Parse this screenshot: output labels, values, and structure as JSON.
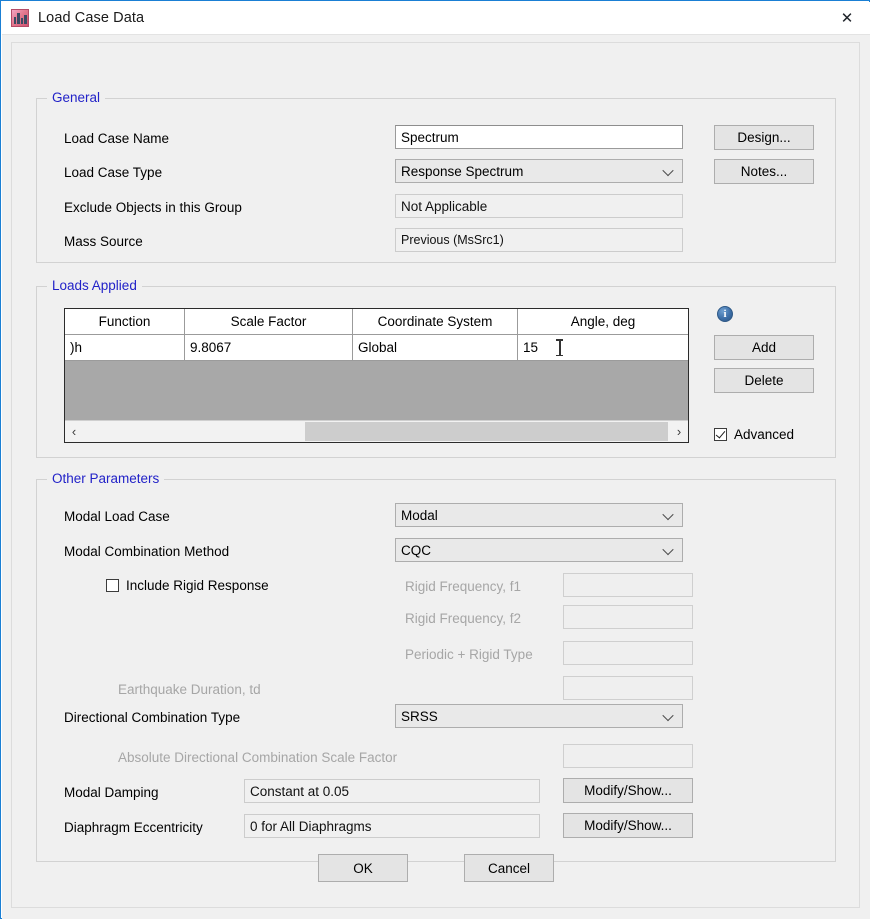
{
  "window": {
    "title": "Load Case Data",
    "icon": "building-icon",
    "close_label": "✕"
  },
  "general": {
    "legend": "General",
    "rows": [
      {
        "label": "Load Case Name",
        "value": "Spectrum",
        "kind": "textbox"
      },
      {
        "label": "Load Case Type",
        "value": "Response Spectrum",
        "kind": "combo"
      },
      {
        "label": "Exclude Objects in this Group",
        "value": "Not Applicable",
        "kind": "readonly"
      },
      {
        "label": "Mass Source",
        "value": "Previous  (MsSrc1)",
        "kind": "readonly"
      }
    ],
    "design_button": "Design...",
    "notes_button": "Notes..."
  },
  "loads_applied": {
    "legend": "Loads Applied",
    "columns": [
      "Function",
      "Scale Factor",
      "Coordinate System",
      "Angle, deg"
    ],
    "rows": [
      {
        "function": ")h",
        "scale_factor": "9.8067",
        "coordinate_system": "Global",
        "angle": "15"
      }
    ],
    "info_icon": "info-icon",
    "info_glyph": "i",
    "add_button": "Add",
    "delete_button": "Delete",
    "advanced_checkbox": {
      "label": "Advanced",
      "checked": true
    },
    "scroll_left_glyph": "‹",
    "scroll_right_glyph": "›"
  },
  "other_parameters": {
    "legend": "Other Parameters",
    "modal_load_case": {
      "label": "Modal Load Case",
      "value": "Modal"
    },
    "modal_combination_method": {
      "label": "Modal Combination Method",
      "value": "CQC"
    },
    "include_rigid_response": {
      "label": "Include Rigid Response",
      "checked": false
    },
    "rigid_frequency_f1": {
      "label": "Rigid Frequency, f1",
      "value": "",
      "disabled": true
    },
    "rigid_frequency_f2": {
      "label": "Rigid Frequency, f2",
      "value": "",
      "disabled": true
    },
    "periodic_rigid_type": {
      "label": "Periodic + Rigid Type",
      "value": "",
      "disabled": true
    },
    "earthquake_duration": {
      "label": "Earthquake Duration, td",
      "value": "",
      "disabled": true
    },
    "directional_combination_type": {
      "label": "Directional Combination Type",
      "value": "SRSS"
    },
    "absolute_directional_scale_factor": {
      "label": "Absolute Directional Combination Scale Factor",
      "value": "",
      "disabled": true
    },
    "modal_damping": {
      "label": "Modal Damping",
      "value": "Constant at 0.05",
      "button": "Modify/Show..."
    },
    "diaphragm_eccentricity": {
      "label": "Diaphragm Eccentricity",
      "value": "0 for All Diaphragms",
      "button": "Modify/Show..."
    }
  },
  "footer": {
    "ok_button": "OK",
    "cancel_button": "Cancel"
  },
  "colors": {
    "legend_text": "#2222c8",
    "window_border": "#1a7fd4",
    "dialog_bg": "#f0f0f0",
    "grid_empty": "#a8a8a8",
    "info_blue": "#3d6fa8"
  }
}
